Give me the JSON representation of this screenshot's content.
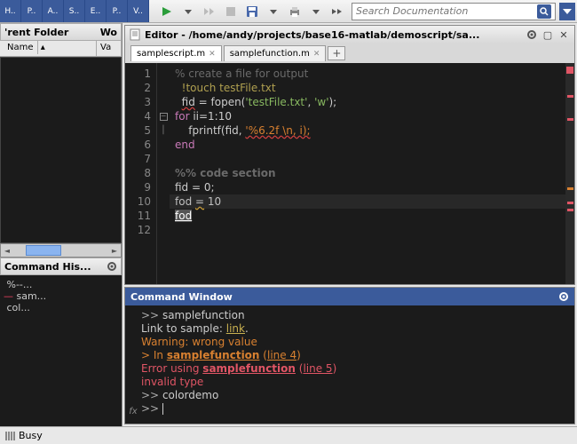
{
  "toolbar": {
    "tabs": [
      "H..",
      "P..",
      "A..",
      "S..",
      "E..",
      "P..",
      "V.."
    ],
    "search_placeholder": "Search Documentation"
  },
  "folder": {
    "title_left": "'rent Folder",
    "title_right": "Wo",
    "cols": {
      "name": "Name",
      "value": "Va"
    }
  },
  "history": {
    "title": "Command His...",
    "items": [
      {
        "marker": "",
        "text": "%--..."
      },
      {
        "marker": "—",
        "text": "sam..."
      },
      {
        "marker": "",
        "text": "col..."
      }
    ]
  },
  "editor": {
    "title": "Editor - /home/andy/projects/base16-matlab/demoscript/sa...",
    "tabs": [
      {
        "label": "samplescript.m",
        "active": true
      },
      {
        "label": "samplefunction.m",
        "active": false
      }
    ],
    "code": {
      "1": {
        "comment": "% create a file for output"
      },
      "2": {
        "cmd_pre": "!",
        "cmd": "touch testFile.txt"
      },
      "3": {
        "varu": "fid",
        "mid": " = fopen(",
        "str": "'testFile.txt'",
        "mid2": ", ",
        "str2": "'w'",
        "end": ");"
      },
      "4": {
        "kw": "for",
        "rest": " ii=1:10"
      },
      "5": {
        "indent": "    fprintf(fid, ",
        "bad": "'%6.2f \\n, i);"
      },
      "6": {
        "kw": "end"
      },
      "7": {
        "blank": " "
      },
      "8": {
        "head": "%% code section"
      },
      "9": {
        "text": "fid = 0;"
      },
      "10": {
        "pre": "fod ",
        "eq": "=",
        "post": " 10"
      },
      "11": {
        "sel": "fod"
      },
      "12": {
        "blank": " "
      }
    }
  },
  "command": {
    "title": "Command Window",
    "lines": {
      "l1": {
        "prompt": ">> ",
        "text": "samplefunction"
      },
      "l2": {
        "pre": "Link to sample: ",
        "link": "link",
        "post": "."
      },
      "l3": {
        "warn": "Warning: wrong value"
      },
      "l4": {
        "warn_pre": "> In ",
        "func": "samplefunction",
        "warn_mid": " (",
        "line": "line 4",
        "warn_post": ")"
      },
      "l5": {
        "err_pre": "Error using ",
        "func": "samplefunction",
        "err_mid": " (",
        "line": "line 5",
        "err_post": ")"
      },
      "l6": {
        "err": "invalid type"
      },
      "l7": {
        "prompt": ">> ",
        "text": "colordemo"
      },
      "l8": {
        "prompt": ">> "
      }
    }
  },
  "status": {
    "text": "Busy"
  }
}
